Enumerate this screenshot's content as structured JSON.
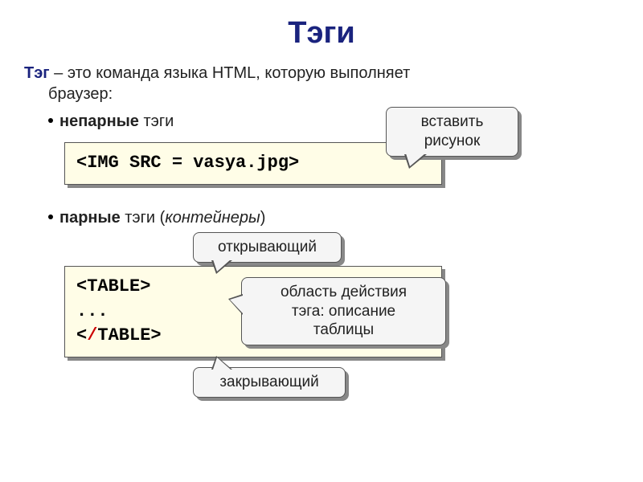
{
  "title": "Тэги",
  "intro": {
    "term": "Тэг",
    "rest_line1": " – это команда языка HTML, которую выполняет",
    "line2": "браузер:"
  },
  "bullet1": {
    "bold": "непарные",
    "rest": " тэги"
  },
  "codebox1": "<IMG SRC = vasya.jpg>",
  "callout1": {
    "line1": "вставить",
    "line2": "рисунок"
  },
  "bullet2": {
    "bold": "парные",
    "rest": " тэги (",
    "italic": "контейнеры",
    "after": ")"
  },
  "codebox2": {
    "open": "<TABLE>",
    "mid": "...",
    "close_open": "<",
    "close_slash": "/",
    "close_rest": "TABLE>"
  },
  "callout2": "открывающий",
  "callout3": {
    "line1": "область действия",
    "line2": "тэга: описание",
    "line3": "таблицы"
  },
  "callout4": "закрывающий"
}
